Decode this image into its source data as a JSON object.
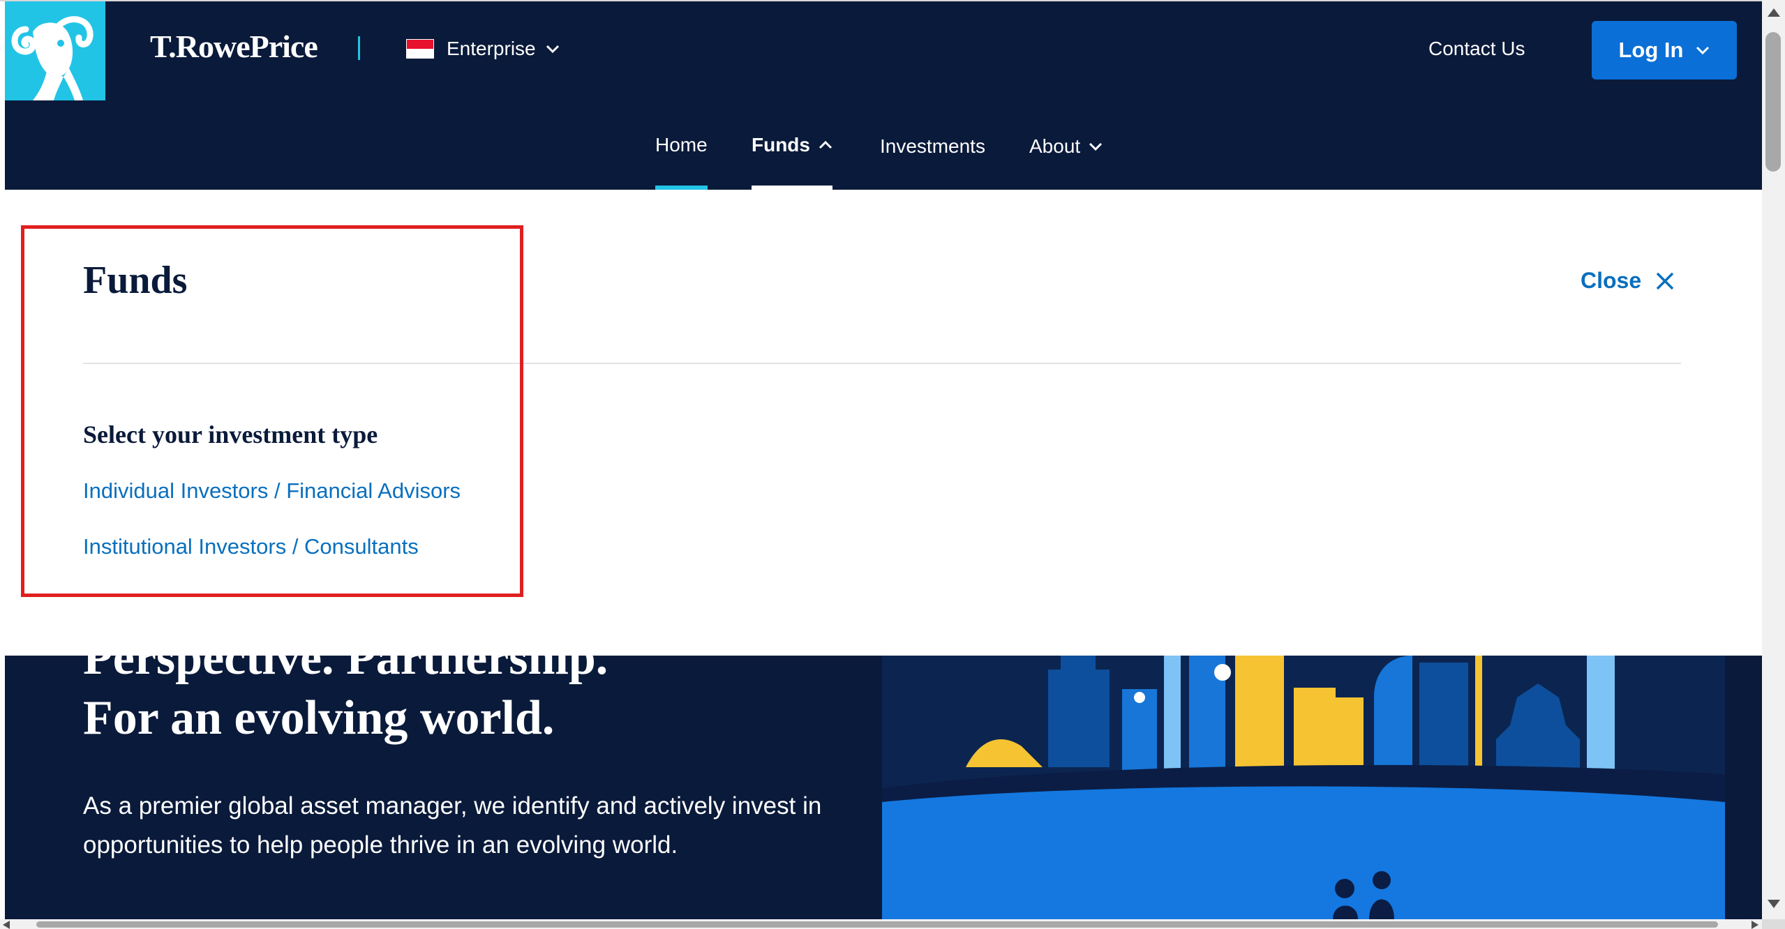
{
  "header": {
    "brand": "T.RowePrice",
    "region_label": "Enterprise",
    "contact_label": "Contact Us",
    "login_label": "Log In"
  },
  "nav": {
    "items": [
      {
        "label": "Home"
      },
      {
        "label": "Funds"
      },
      {
        "label": "Investments"
      },
      {
        "label": "About"
      }
    ]
  },
  "panel": {
    "title": "Funds",
    "close_label": "Close",
    "subheading": "Select your investment type",
    "links": [
      "Individual Investors / Financial Advisors",
      "Institutional Investors / Consultants"
    ]
  },
  "hero": {
    "headline_partial": "Perspective. Partnership.",
    "headline": "For an evolving world.",
    "body": "As a premier global asset manager, we identify and actively invest in opportunities to help people thrive in an evolving world."
  },
  "colors": {
    "navy": "#0a1a3a",
    "accent_cyan": "#22c4e6",
    "button_blue": "#0a6fd6",
    "link_blue": "#0a6fbd",
    "highlight_red": "#e01f1f"
  },
  "icons": [
    "ram-logo-icon",
    "singapore-flag-icon",
    "chevron-down-icon",
    "chevron-up-icon",
    "close-icon"
  ]
}
